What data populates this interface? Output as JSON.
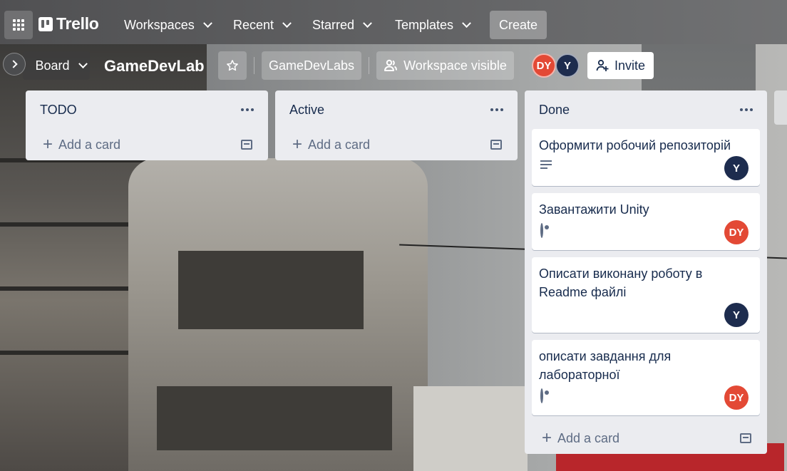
{
  "nav": {
    "logo": "Trello",
    "workspaces": "Workspaces",
    "recent": "Recent",
    "starred": "Starred",
    "templates": "Templates",
    "create": "Create"
  },
  "board": {
    "view": "Board",
    "title": "GameDevLab",
    "workspace": "GameDevLabs",
    "visibility": "Workspace visible",
    "members": [
      "DY",
      "Y"
    ],
    "invite": "Invite"
  },
  "lists": [
    {
      "title": "TODO",
      "add_card": "Add a card",
      "cards": []
    },
    {
      "title": "Active",
      "add_card": "Add a card",
      "cards": []
    },
    {
      "title": "Done",
      "add_card": "Add a card",
      "cards": [
        {
          "title": "Оформити робочий репозиторій",
          "badge": "description-icon",
          "member": "Y"
        },
        {
          "title": "Завантажити Unity",
          "badge": "eye-icon",
          "member": "DY"
        },
        {
          "title": "Описати виконану роботу в Readme файлі",
          "badge": "",
          "member": "Y"
        },
        {
          "title": "описати завдання для лабораторної",
          "badge": "eye-icon",
          "member": "DY"
        }
      ]
    }
  ],
  "colors": {
    "avatar_dy": "#e34935",
    "avatar_y": "#1d2c4e",
    "list_bg": "#ebecf0"
  }
}
